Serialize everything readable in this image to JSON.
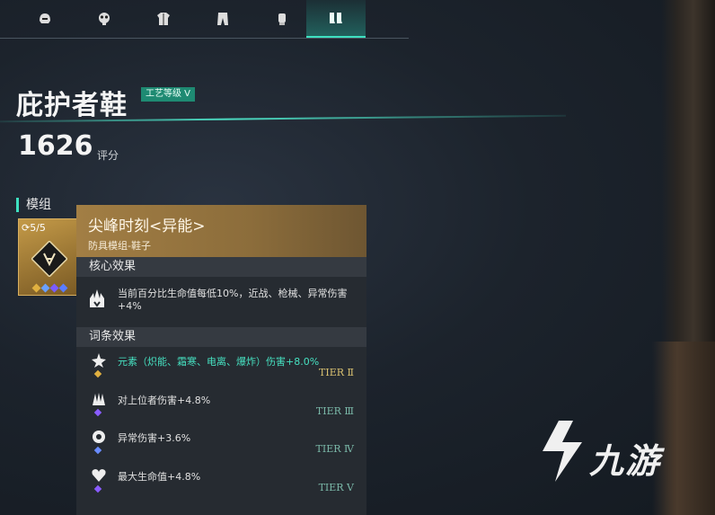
{
  "tabs": [
    {
      "name": "helmet-icon",
      "active": false
    },
    {
      "name": "gasmask-icon",
      "active": false
    },
    {
      "name": "chest-armor-icon",
      "active": false
    },
    {
      "name": "pants-icon",
      "active": false
    },
    {
      "name": "glove-icon",
      "active": false
    },
    {
      "name": "boots-icon",
      "active": true
    }
  ],
  "item": {
    "title": "庇护者鞋",
    "craft_badge": "工艺等级 Ⅴ",
    "score": "1626",
    "score_label": "评分"
  },
  "module": {
    "section_title": "模组",
    "count": "5/5",
    "gem_colors": [
      "#e0b040",
      "#6aa0ff",
      "#7a5cff",
      "#5a7cff"
    ]
  },
  "tooltip": {
    "name": "尖峰时刻<异能>",
    "subtitle": "防具模组-鞋子",
    "core_header": "核心效果",
    "core_text": "当前百分比生命值每低10%，近战、枪械、异常伤害+4%",
    "affix_header": "词条效果",
    "affixes": [
      {
        "text": "元素（炽能、霜寒、电离、爆炸）伤害+8.0%",
        "tier": "TIER Ⅱ",
        "highlight": true,
        "gem_color": "#e0b040",
        "icon": "flame-star-icon"
      },
      {
        "text": "对上位者伤害+4.8%",
        "tier": "TIER Ⅲ",
        "highlight": false,
        "gem_color": "#8a5cff",
        "icon": "claw-icon"
      },
      {
        "text": "异常伤害+3.6%",
        "tier": "TIER Ⅳ",
        "highlight": false,
        "gem_color": "#6a8cff",
        "icon": "anomaly-icon"
      },
      {
        "text": "最大生命值+4.8%",
        "tier": "TIER Ⅴ",
        "highlight": false,
        "gem_color": "#8a5cff",
        "icon": "heart-icon"
      }
    ]
  },
  "watermark": "九游"
}
